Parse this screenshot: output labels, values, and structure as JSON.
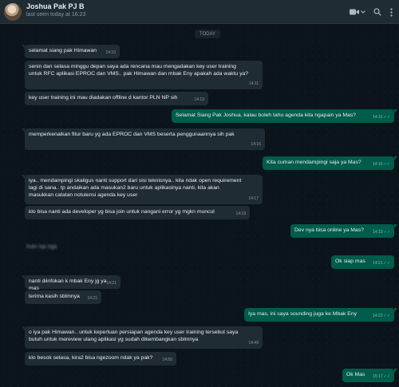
{
  "header": {
    "contact_name": "Joshua Pak PJ B",
    "status": "last seen today at 16:23",
    "icons": [
      "video-call-icon",
      "chevron-down-icon",
      "search-icon",
      "menu-icon"
    ]
  },
  "date_separator": "TODAY",
  "blurred_preview": "hulo nja nga",
  "messages": [
    {
      "dir": "in",
      "text": "selamat siang pak Himawan",
      "time": "14:10"
    },
    {
      "dir": "in",
      "text": "senin dan selasa minggu depan saya ada rencana mau mengadakan key user training\nuntuk RFC aplikasi EPROC dan VMS.. pak Himawan dan mbak Eny apakah ada waktu ya?",
      "time": "14:11"
    },
    {
      "dir": "in",
      "text": "key user training ini mau diadakan offline d kantor PLN NP sih",
      "time": "14:13"
    },
    {
      "dir": "out",
      "text": "Selamat Siang Pak Joshua, kalau boleh tahu agenda kita ngapain ya Mas?",
      "time": "14:15"
    },
    {
      "dir": "in",
      "text": "memperkenalkan fitur baru yg ada EPROC dan VMS beserta penggunaannya sih pak",
      "time": "14:16"
    },
    {
      "dir": "out",
      "text": "Kita cuman mendampingi saja ya Mas?",
      "time": "14:16"
    },
    {
      "dir": "in",
      "text": "iya.. mendampingi skaligus nanti support dari sisi teknisnya.. kita ndak open requirement\nlagi di sana.. tp andaikan ada masukan2 baru untuk aplikasinya nanti, kita akan\nmasukkan catatan notulensi agenda key user",
      "time": "14:17"
    },
    {
      "dir": "in",
      "text": "klo bisa nanti ada developer yg bisa join untuk nangani error yg mgkn muncul",
      "time": "14:18"
    },
    {
      "dir": "out",
      "text": "Dev nya bisa online ya Mas?",
      "time": "14:19"
    },
    {
      "dir": "out",
      "text": "Ok siap mas",
      "time": "14:21"
    },
    {
      "dir": "in",
      "text": "nanti diinfokan k mbak Eny jg ya mas",
      "time": "14:21"
    },
    {
      "dir": "in",
      "text": "terima kasih sblmnya",
      "time": "14:21"
    },
    {
      "dir": "out",
      "text": "Iya mas, ini saya sounding juga ke Mbak Eny",
      "time": "14:22"
    },
    {
      "dir": "in",
      "text": "o iya pak Himawan.. untuk keperluan persiapan agenda key user training tersebut saya\nbutuh untuk mereview ulang aplikasi yg sudah dikembangkan sblmnya",
      "time": "14:49"
    },
    {
      "dir": "in",
      "text": "klo besok selasa, kira2 bisa ngezoom ndak ya pak?",
      "time": "14:50"
    },
    {
      "dir": "out",
      "text": "Ok Mas",
      "time": "15:17"
    }
  ],
  "colors": {
    "background": "#0b141a",
    "header": "#202c33",
    "incoming_bubble": "#202c33",
    "outgoing_bubble": "#005c4b",
    "read_tick": "#53bdeb"
  }
}
